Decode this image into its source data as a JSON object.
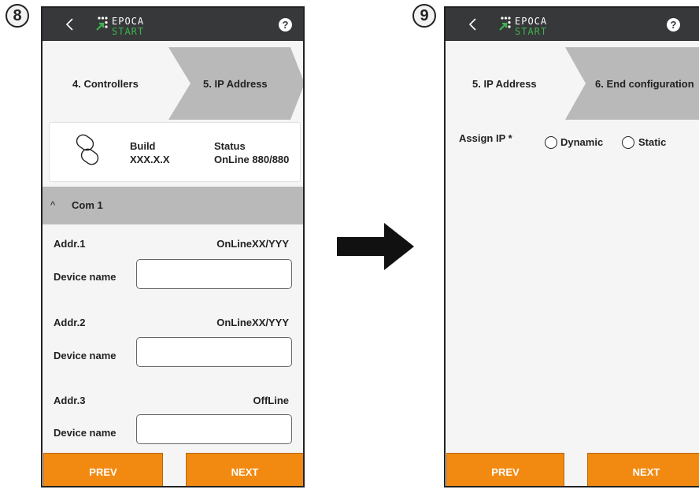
{
  "screen8": {
    "step_number": "8",
    "step_prev": "4. Controllers",
    "step_current": "5.  IP Address",
    "card": {
      "build_label": "Build",
      "build_value": "XXX.X.X",
      "status_label": "Status",
      "status_value": "OnLine 880/880"
    },
    "accordion_title": "Com 1",
    "devices": [
      {
        "addr": "Addr.1",
        "status": "OnLineXX/YYY",
        "name_label": "Device name",
        "name_value": ""
      },
      {
        "addr": "Addr.2",
        "status": "OnLineXX/YYY",
        "name_label": "Device name",
        "name_value": ""
      },
      {
        "addr": "Addr.3",
        "status": "OffLine",
        "name_label": "Device name",
        "name_value": ""
      }
    ],
    "prev_label": "PREV",
    "next_label": "NEXT"
  },
  "screen9": {
    "step_number": "9",
    "step_current": "5.  IP Address",
    "step_next": "6. End configuration",
    "assign_label": "Assign IP *",
    "options": [
      "Dynamic",
      "Static"
    ],
    "prev_label": "PREV",
    "next_label": "NEXT"
  },
  "logo": {
    "line1": "EPOCA",
    "line2": "START"
  },
  "help_glyph": "?",
  "back_glyph": "<",
  "chevron_glyph": "^",
  "colors": {
    "topbar": "#36383a",
    "accent": "#f28a12",
    "logo_green": "#3fb34f",
    "step_active": "#b9b9b9"
  }
}
